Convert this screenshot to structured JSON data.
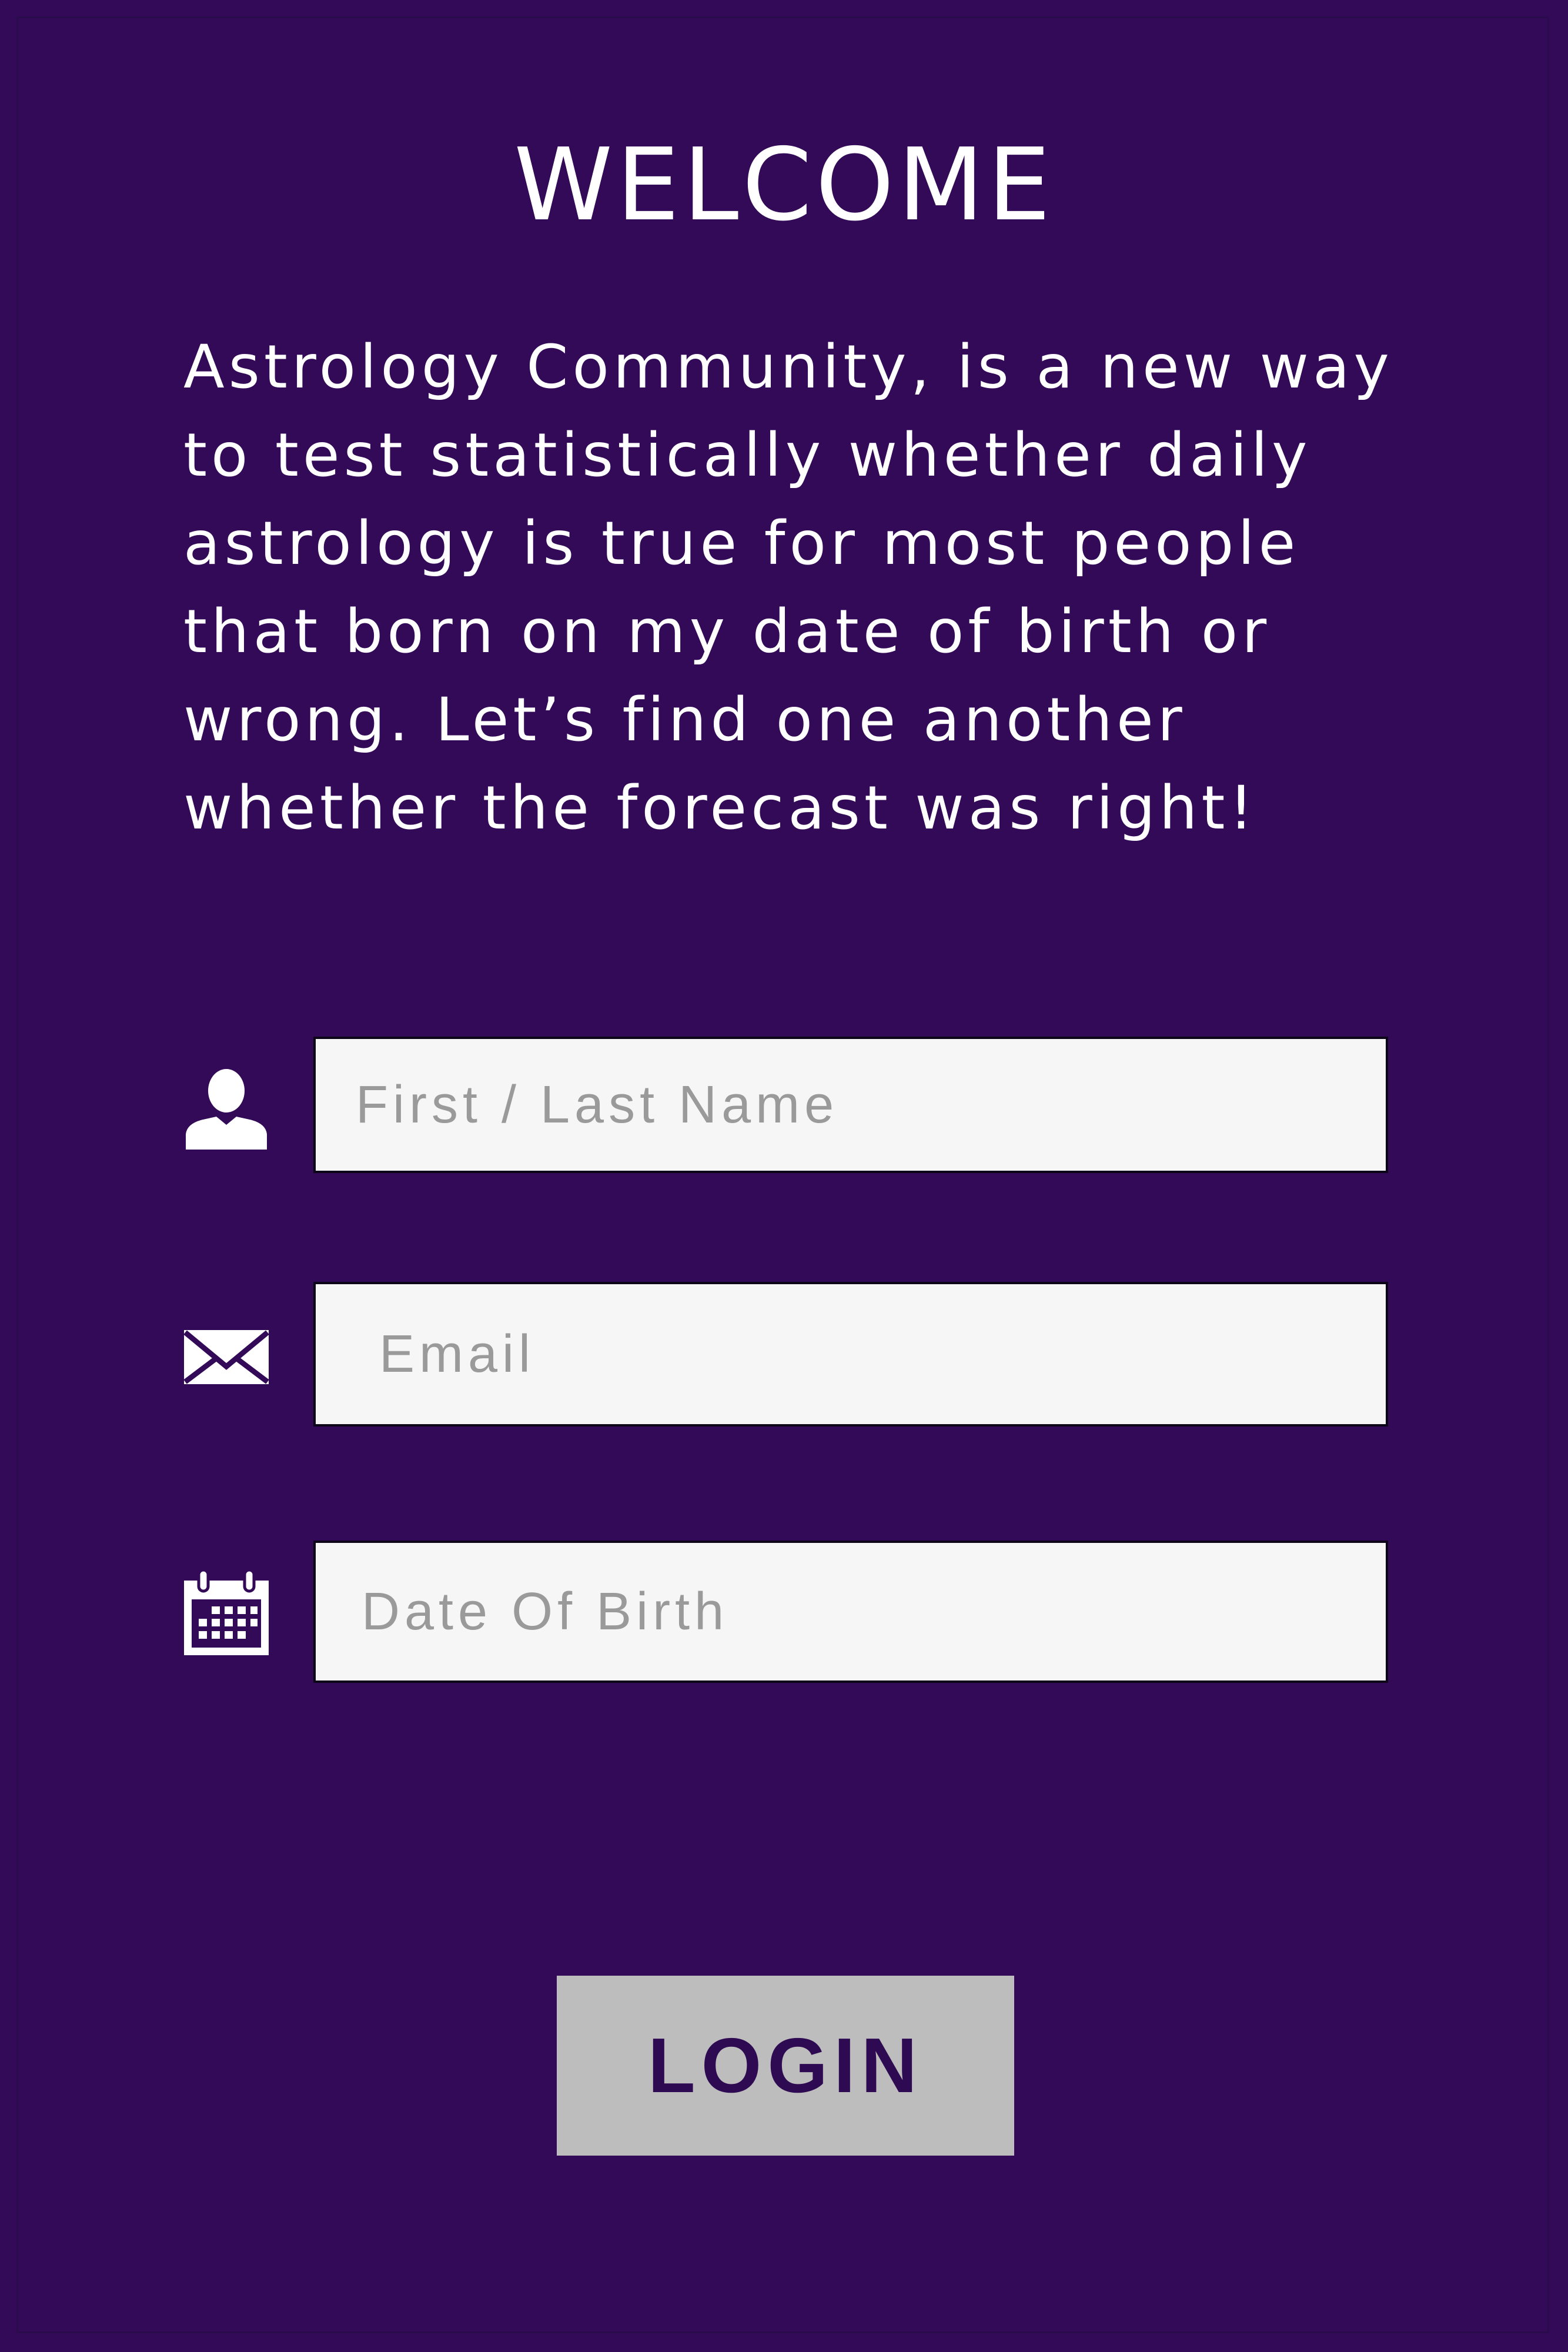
{
  "header": {
    "title": "WELCOME"
  },
  "intro": {
    "text": "Astrology Community, is a new way to test statistically whether daily astrology is true for most people that born on my date of birth or wrong. Let’s find one another whether the forecast was right!"
  },
  "form": {
    "name_field": {
      "icon": "user-icon",
      "placeholder": "First / Last Name"
    },
    "email_field": {
      "icon": "envelope-icon",
      "placeholder": "Email"
    },
    "dob_field": {
      "icon": "calendar-icon",
      "placeholder": "Date Of Birth"
    }
  },
  "actions": {
    "login_label": "LOGIN"
  },
  "colors": {
    "background": "#320a57",
    "field_background": "#f6f6f6",
    "placeholder_text": "#9a9a9a",
    "button_background": "#bdbdbd",
    "button_text": "#2d0a52"
  }
}
